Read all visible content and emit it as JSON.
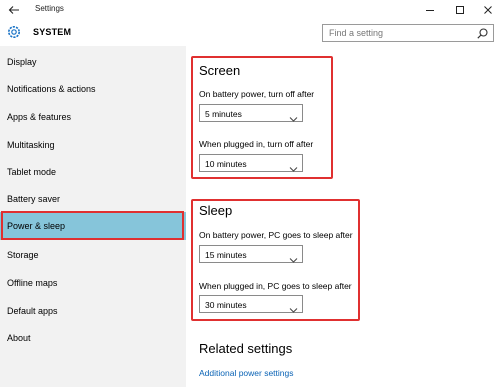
{
  "window": {
    "title": "Settings"
  },
  "header": {
    "section": "SYSTEM",
    "search_placeholder": "Find a setting"
  },
  "sidebar": {
    "items": [
      {
        "label": "Display"
      },
      {
        "label": "Notifications & actions"
      },
      {
        "label": "Apps & features"
      },
      {
        "label": "Multitasking"
      },
      {
        "label": "Tablet mode"
      },
      {
        "label": "Battery saver"
      },
      {
        "label": "Power & sleep"
      },
      {
        "label": "Storage"
      },
      {
        "label": "Offline maps"
      },
      {
        "label": "Default apps"
      },
      {
        "label": "About"
      }
    ],
    "selected": "Power & sleep"
  },
  "screen": {
    "title": "Screen",
    "battery_label": "On battery power, turn off after",
    "battery_value": "5 minutes",
    "plugged_label": "When plugged in, turn off after",
    "plugged_value": "10 minutes"
  },
  "sleep": {
    "title": "Sleep",
    "battery_label": "On battery power, PC goes to sleep after",
    "battery_value": "15 minutes",
    "plugged_label": "When plugged in, PC goes to sleep after",
    "plugged_value": "30 minutes"
  },
  "related": {
    "title": "Related settings",
    "link": "Additional power settings"
  },
  "colors": {
    "selected_bg": "#86c5da",
    "highlight_border": "#e03030",
    "link": "#0a63b5",
    "sidebar_bg": "#f2f2f2"
  },
  "icons": [
    "back-arrow-icon",
    "minimize-icon",
    "maximize-icon",
    "close-icon",
    "gear-icon",
    "search-icon",
    "chevron-down-icon"
  ]
}
